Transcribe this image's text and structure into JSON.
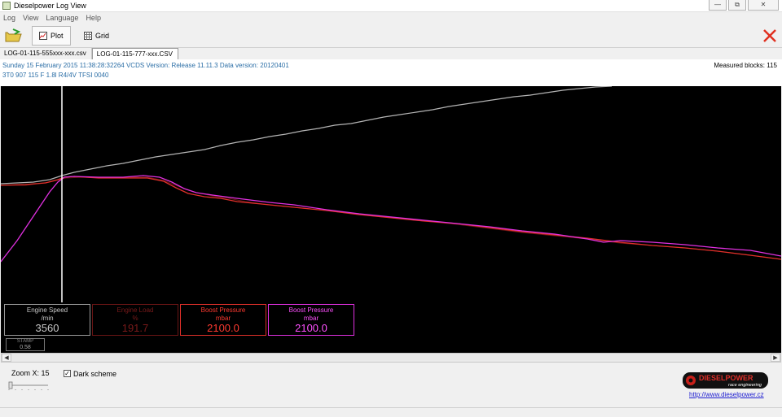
{
  "window": {
    "title": "Dieselpower Log View",
    "buttons": [
      "—",
      "⧉",
      "✕"
    ]
  },
  "menu": [
    "Log",
    "View",
    "Language",
    "Help"
  ],
  "toolbar": {
    "open_icon": "open-folder-icon",
    "plot_label": "Plot",
    "grid_label": "Grid",
    "close_icon": "close-x-icon"
  },
  "tabs": [
    "LOG-01-115-555xxx-xxx.csv",
    "LOG-01-115-777-xxx.CSV"
  ],
  "info": {
    "line1": "Sunday 15 February 2015 11:38:28:32264 VCDS Version: Release 11.11.3 Data version: 20120401",
    "line2": "3T0 907 115 F  1.8l R4/4V TFSI     0040",
    "measured_blocks": "Measured blocks: 115"
  },
  "colors": {
    "engine_speed": "#c8c8c8",
    "engine_load": "#8b1a1a",
    "boost_pressure_1": "#e0302a",
    "boost_pressure_2": "#e030e0",
    "cursor": "#ffffff",
    "background": "#000000"
  },
  "gauges": [
    {
      "name": "Engine Speed",
      "unit": "/min",
      "value": "3560",
      "color": "#c8c8c8",
      "border": "#9a9a9a"
    },
    {
      "name": "Engine Load",
      "unit": "%",
      "value": "191.7",
      "color": "#7a1a1a",
      "border": "#6a1515"
    },
    {
      "name": "Boost Pressure",
      "unit": "mbar",
      "value": "2100.0",
      "color": "#ff3a30",
      "border": "#e0302a"
    },
    {
      "name": "Boost Pressure",
      "unit": "mbar",
      "value": "2100.0",
      "color": "#ff50ff",
      "border": "#e030e0"
    }
  ],
  "stamp": {
    "name": "STAMP",
    "value": "0.58"
  },
  "bottom": {
    "zoom_label": "Zoom X: 15",
    "dark_scheme_label": "Dark scheme",
    "dark_scheme_checked": true,
    "logo_text": "DIESELPOWER",
    "logo_subtext": "race engineering",
    "link": "http://www.dieselpower.cz"
  }
}
